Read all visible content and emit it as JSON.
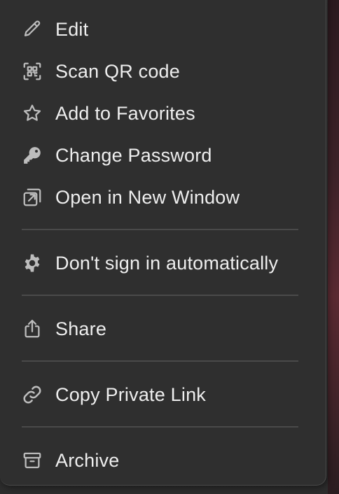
{
  "menu": {
    "items": [
      {
        "label": "Edit",
        "icon": "pencil-icon"
      },
      {
        "label": "Scan QR code",
        "icon": "qr-code-icon"
      },
      {
        "label": "Add to Favorites",
        "icon": "star-icon"
      },
      {
        "label": "Change Password",
        "icon": "key-icon"
      },
      {
        "label": "Open in New Window",
        "icon": "external-window-icon"
      },
      {
        "label": "Don't sign in automatically",
        "icon": "gear-icon"
      },
      {
        "label": "Share",
        "icon": "share-icon"
      },
      {
        "label": "Copy Private Link",
        "icon": "link-icon"
      },
      {
        "label": "Archive",
        "icon": "archive-icon"
      }
    ]
  },
  "colors": {
    "menu_background": "#2f2f2f",
    "text": "#eeeeee",
    "icon": "#bdbdbd",
    "divider": "#4a4a4a"
  }
}
